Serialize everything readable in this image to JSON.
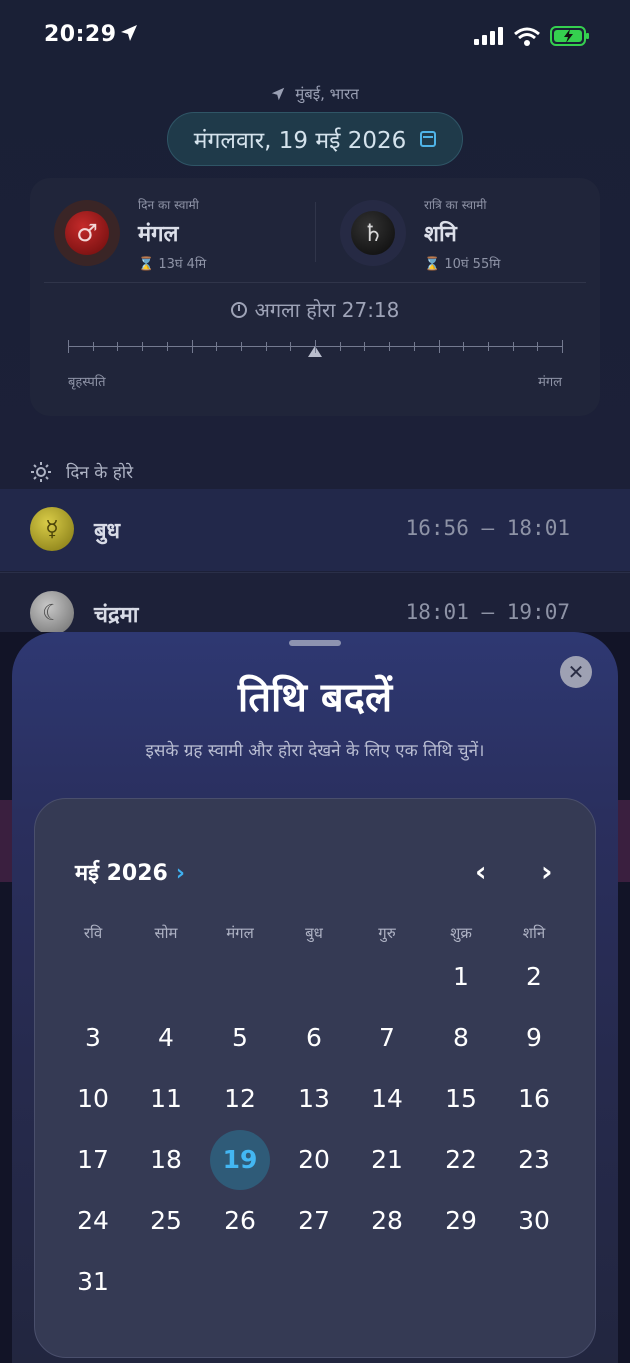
{
  "status": {
    "time": "20:29"
  },
  "location": "मुंबई, भारत",
  "date_pill": "मंगलवार, 19 मई 2026",
  "day_lord": {
    "caption": "दिन का स्वामी",
    "name": "मंगल",
    "duration": "⌛ 13घं 4मि",
    "symbol": "♂"
  },
  "night_lord": {
    "caption": "रात्रि का स्वामी",
    "name": "शनि",
    "duration": "⌛ 10घं 55मि",
    "symbol": "♄"
  },
  "next_hora": "अगला होरा 27:18",
  "timeline": {
    "left": "बृहस्पति",
    "right": "मंगल"
  },
  "day_horas_heading": "दिन के होरे",
  "horas": [
    {
      "name": "बुध",
      "time": "16:56 – 18:01",
      "symbol": "☿"
    },
    {
      "name": "चंद्रमा",
      "time": "18:01 – 19:07",
      "symbol": "☾"
    }
  ],
  "sheet": {
    "title": "तिथि बदलें",
    "subtitle": "इसके ग्रह स्वामी और होरा देखने के लिए एक तिथि चुनें।",
    "close": "✕"
  },
  "calendar": {
    "month": "मई 2026",
    "month_chevron": "›",
    "prev": "‹",
    "next": "›",
    "weekdays": [
      "रवि",
      "सोम",
      "मंगल",
      "बुध",
      "गुरु",
      "शुक्र",
      "शनि"
    ],
    "days": [
      "1",
      "2",
      "3",
      "4",
      "5",
      "6",
      "7",
      "8",
      "9",
      "10",
      "11",
      "12",
      "13",
      "14",
      "15",
      "16",
      "17",
      "18",
      "19",
      "20",
      "21",
      "22",
      "23",
      "24",
      "25",
      "26",
      "27",
      "28",
      "29",
      "30",
      "31"
    ],
    "first_weekday_index": 5,
    "selected": "19"
  },
  "colors": {
    "accent": "#43b7f3",
    "selected_bg": "#2f5b78"
  }
}
